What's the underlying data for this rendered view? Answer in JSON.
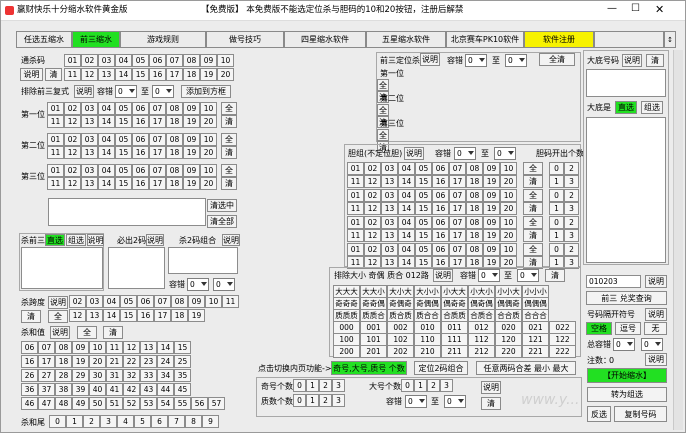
{
  "window": {
    "title": "赢财快乐十分缩水软件黄金版",
    "notice": "【免费版】 本免费版不能选定位杀与胆码的10和20按钮，注册后解禁",
    "controls": [
      "—",
      "☐",
      "✕"
    ]
  },
  "tabs": [
    "任选五缩水",
    "前三缩水",
    "游戏规则",
    "做号技巧",
    "四星缩水软件",
    "五星缩水软件",
    "北京赛车PK10软件",
    "软件注册"
  ],
  "active_tab": 1,
  "common": {
    "tongbu": "通杀码",
    "explain": "说明",
    "clear": "清",
    "all": "全",
    "numbers_1_10": [
      "01",
      "02",
      "03",
      "04",
      "05",
      "06",
      "07",
      "08",
      "09",
      "10"
    ],
    "numbers_11_20": [
      "11",
      "12",
      "13",
      "14",
      "15",
      "16",
      "17",
      "18",
      "19",
      "20"
    ]
  },
  "left": {
    "exclude_fushi": "排除前三复式",
    "tolerance": "容错",
    "to": "至",
    "dd_zero": "0",
    "add_to_scheme": "添加到方框",
    "positions": [
      "第一位",
      "第二位",
      "第三位"
    ],
    "clear_selected": "清选中",
    "delete_all": "清全部",
    "kill_front3": "杀前三",
    "direct": "直选",
    "group": "组选",
    "must_out2": "必出2码",
    "kill2_combo": "杀2码组合",
    "span": "杀跨度",
    "span_nums": [
      "02",
      "03",
      "04",
      "05",
      "06",
      "07",
      "08",
      "09",
      "10",
      "11"
    ],
    "span_nums2": [
      "12",
      "13",
      "14",
      "15",
      "16",
      "17",
      "18",
      "19"
    ],
    "sum_label": "杀和值",
    "sum_rows": [
      [
        "06",
        "07",
        "08",
        "09",
        "10",
        "11",
        "12",
        "13",
        "14",
        "15"
      ],
      [
        "16",
        "17",
        "18",
        "19",
        "20",
        "21",
        "22",
        "23",
        "24",
        "25"
      ],
      [
        "26",
        "27",
        "28",
        "29",
        "30",
        "31",
        "32",
        "33",
        "34",
        "35"
      ],
      [
        "36",
        "37",
        "38",
        "39",
        "40",
        "41",
        "42",
        "43",
        "44",
        "45"
      ],
      [
        "46",
        "47",
        "48",
        "49",
        "50",
        "51",
        "52",
        "53",
        "54",
        "55",
        "56",
        "57"
      ]
    ],
    "bottom_label": "杀和尾",
    "bottom_nums": [
      "0",
      "1",
      "2",
      "3",
      "4",
      "5",
      "6",
      "7",
      "8",
      "9"
    ]
  },
  "middle": {
    "front3_kill": "前三定位杀",
    "positions": [
      "第一位",
      "第二位",
      "第三位"
    ],
    "dan_group": "胆组(不定位胆)",
    "dan_out": "胆码开出个数",
    "dan_counts_a": [
      "0",
      "2"
    ],
    "dan_counts_b": [
      "1",
      "3"
    ],
    "exclude_size": "排除大小 奇偶 质合 012路",
    "size_row1": [
      "大大大",
      "大大小",
      "大小大",
      "大小小",
      "小大大",
      "小大小",
      "小小大",
      "小小小"
    ],
    "size_row2": [
      "奇奇奇",
      "奇奇偶",
      "奇偶奇",
      "奇偶偶",
      "偶奇奇",
      "偶奇偶",
      "偶偶奇",
      "偶偶偶"
    ],
    "size_row3": [
      "质质质",
      "质质合",
      "质合质",
      "质合合",
      "合质质",
      "合质合",
      "合合质",
      "合合合"
    ],
    "route_rows": [
      [
        "000",
        "001",
        "002",
        "010",
        "011",
        "012",
        "020",
        "021",
        "022"
      ],
      [
        "100",
        "101",
        "102",
        "110",
        "111",
        "112",
        "120",
        "121",
        "122"
      ],
      [
        "200",
        "201",
        "202",
        "210",
        "211",
        "212",
        "220",
        "221",
        "222"
      ]
    ],
    "switch_label": "点击切换内页功能->",
    "switch_btn1": "奇号,大号,质号 个数",
    "switch_btn2": "定位2码组合",
    "switch_btn3": "任意两码合差 最小 最大",
    "odd_count": "奇号个数",
    "big_count": "大号个数",
    "prime_count": "质数个数",
    "count_nums": [
      "0",
      "1",
      "2",
      "3"
    ]
  },
  "right": {
    "dm_label": "大底号码",
    "dd_label": "大底是",
    "direct": "直选",
    "group": "组选",
    "input_value": "010203",
    "front3_query": "前三 兑奖查询",
    "sep_label": "号码隔开符号",
    "space": "空格",
    "comma": "逗号",
    "none": "无",
    "total_tol": "总容错",
    "note_count": "注数：",
    "note_val": "0",
    "start": "【开始缩水】",
    "to_group": "转为组选",
    "invert": "反选",
    "copy": "复制号码"
  },
  "watermark": "www.y..."
}
